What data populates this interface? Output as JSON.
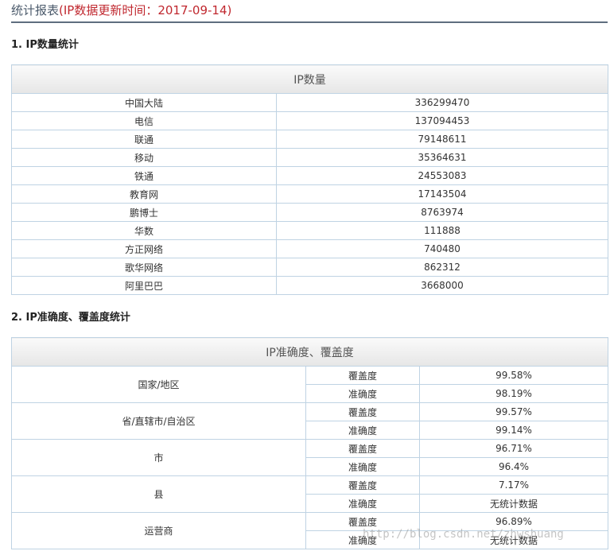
{
  "header": {
    "title": "统计报表",
    "subtitle": "(IP数据更新时间：2017-09-14)"
  },
  "section1": {
    "heading": "1. IP数量统计",
    "table_header": "IP数量",
    "rows": [
      {
        "name": "中国大陆",
        "value": "336299470"
      },
      {
        "name": "电信",
        "value": "137094453"
      },
      {
        "name": "联通",
        "value": "79148611"
      },
      {
        "name": "移动",
        "value": "35364631"
      },
      {
        "name": "铁通",
        "value": "24553083"
      },
      {
        "name": "教育网",
        "value": "17143504"
      },
      {
        "name": "鹏博士",
        "value": "8763974"
      },
      {
        "name": "华数",
        "value": "111888"
      },
      {
        "name": "方正网络",
        "value": "740480"
      },
      {
        "name": "歌华网络",
        "value": "862312"
      },
      {
        "name": "阿里巴巴",
        "value": "3668000"
      }
    ]
  },
  "section2": {
    "heading": "2. IP准确度、覆盖度统计",
    "table_header": "IP准确度、覆盖度",
    "groups": [
      {
        "name": "国家/地区",
        "rows": [
          {
            "metric": "覆盖度",
            "value": "99.58%"
          },
          {
            "metric": "准确度",
            "value": "98.19%"
          }
        ]
      },
      {
        "name": "省/直辖市/自治区",
        "rows": [
          {
            "metric": "覆盖度",
            "value": "99.57%"
          },
          {
            "metric": "准确度",
            "value": "99.14%"
          }
        ]
      },
      {
        "name": "市",
        "rows": [
          {
            "metric": "覆盖度",
            "value": "96.71%"
          },
          {
            "metric": "准确度",
            "value": "96.4%"
          }
        ]
      },
      {
        "name": "县",
        "rows": [
          {
            "metric": "覆盖度",
            "value": "7.17%"
          },
          {
            "metric": "准确度",
            "value": "无统计数据"
          }
        ]
      },
      {
        "name": "运营商",
        "rows": [
          {
            "metric": "覆盖度",
            "value": "96.89%"
          },
          {
            "metric": "准确度",
            "value": "无统计数据"
          }
        ]
      }
    ]
  },
  "watermark": "http://blog.csdn.net/zhwshuang"
}
